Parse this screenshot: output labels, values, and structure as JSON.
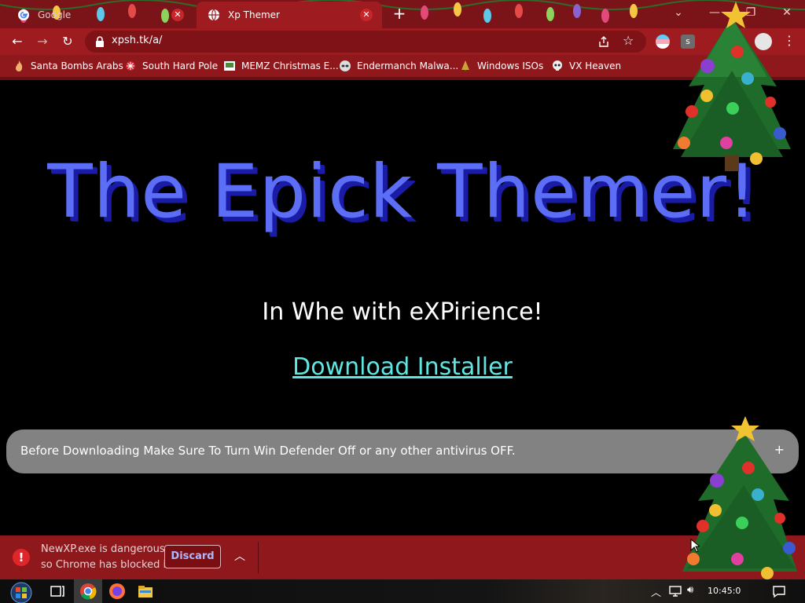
{
  "tabs": [
    {
      "title": "Google",
      "active": false
    },
    {
      "title": "Xp Themer",
      "active": true
    }
  ],
  "toolbar": {
    "url": "xpsh.tk/a/"
  },
  "bookmarks": [
    {
      "label": "Santa Bombs Arabs",
      "icon": "flame-icon"
    },
    {
      "label": "South Hard Pole",
      "icon": "snowflake-icon"
    },
    {
      "label": "MEMZ Christmas E...",
      "icon": "memz-icon"
    },
    {
      "label": "Endermanch Malwa...",
      "icon": "raccoon-icon"
    },
    {
      "label": "Windows ISOs",
      "icon": "tree-icon"
    },
    {
      "label": "VX Heaven",
      "icon": "skull-icon"
    }
  ],
  "page": {
    "heading": "The Epick Themer!",
    "tagline": "In Whe with eXPirience!",
    "download_link": "Download Installer",
    "notice": "Before Downloading Make Sure To Turn Win Defender Off or any other antivirus OFF.",
    "notice_toggle": "+"
  },
  "download_bar": {
    "line1": "NewXP.exe is dangerous,",
    "line2": "so Chrome has blocked it.",
    "discard_label": "Discard"
  },
  "taskbar": {
    "clock": "10:45:0"
  },
  "colors": {
    "chrome_frame": "#9e1b1f",
    "heading": "#5b6ef5",
    "heading_shadow": "#1a1ca6",
    "link": "#5fe6e2",
    "notice_bg": "#828282"
  }
}
